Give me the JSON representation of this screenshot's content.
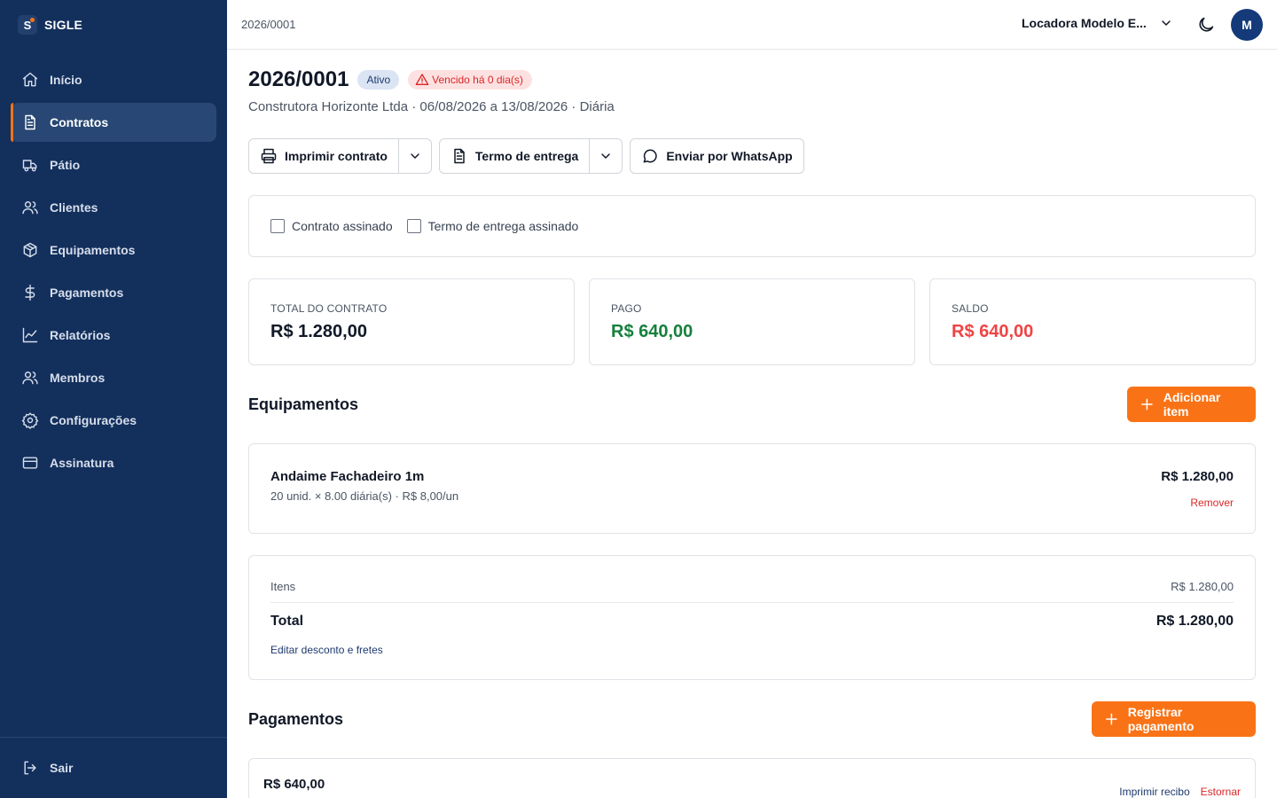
{
  "brand": {
    "logo_letter": "S",
    "name": "SIGLE"
  },
  "sidebar": {
    "items": [
      {
        "label": "Início",
        "icon": "home-icon"
      },
      {
        "label": "Contratos",
        "icon": "document-icon",
        "active": true
      },
      {
        "label": "Pátio",
        "icon": "truck-icon"
      },
      {
        "label": "Clientes",
        "icon": "users-icon"
      },
      {
        "label": "Equipamentos",
        "icon": "box-icon"
      },
      {
        "label": "Pagamentos",
        "icon": "dollar-icon"
      },
      {
        "label": "Relatórios",
        "icon": "chart-icon"
      },
      {
        "label": "Membros",
        "icon": "users-icon"
      },
      {
        "label": "Configurações",
        "icon": "gear-icon"
      },
      {
        "label": "Assinatura",
        "icon": "credit-card-icon"
      }
    ],
    "logout_label": "Sair"
  },
  "header": {
    "breadcrumb": "2026/0001",
    "organization": "Locadora Modelo E...",
    "avatar_initial": "M"
  },
  "contract": {
    "number": "2026/0001",
    "status": "Ativo",
    "overdue": "Vencido há 0 dia(s)",
    "subtitle": "Construtora Horizonte Ltda · 06/08/2026 a 13/08/2026 · Diária"
  },
  "actions": {
    "print_contract": "Imprimir contrato",
    "delivery_term": "Termo de entrega",
    "whatsapp": "Enviar por WhatsApp"
  },
  "signatures": {
    "contract_signed": "Contrato assinado",
    "delivery_signed": "Termo de entrega assinado"
  },
  "stats": {
    "total_label": "TOTAL DO CONTRATO",
    "total_value": "R$ 1.280,00",
    "paid_label": "PAGO",
    "paid_value": "R$ 640,00",
    "balance_label": "SALDO",
    "balance_value": "R$ 640,00"
  },
  "colors": {
    "paid": "#16a34a",
    "balance": "#ef4444",
    "accent": "#f97316",
    "sidebar": "#132f5c"
  },
  "equipment": {
    "title": "Equipamentos",
    "add_button": "Adicionar item",
    "items": [
      {
        "name": "Andaime Fachadeiro 1m",
        "detail": "20 unid. × 8.00 diária(s) · R$ 8,00/un",
        "price": "R$ 1.280,00",
        "remove": "Remover"
      }
    ]
  },
  "totals": {
    "items_label": "Itens",
    "items_value": "R$ 1.280,00",
    "total_label": "Total",
    "total_value": "R$ 1.280,00",
    "edit_link": "Editar desconto e fretes"
  },
  "payments": {
    "title": "Pagamentos",
    "register_button": "Registrar pagamento",
    "entries": [
      {
        "amount": "R$ 640,00",
        "print_receipt": "Imprimir recibo",
        "reverse": "Estornar"
      }
    ]
  }
}
